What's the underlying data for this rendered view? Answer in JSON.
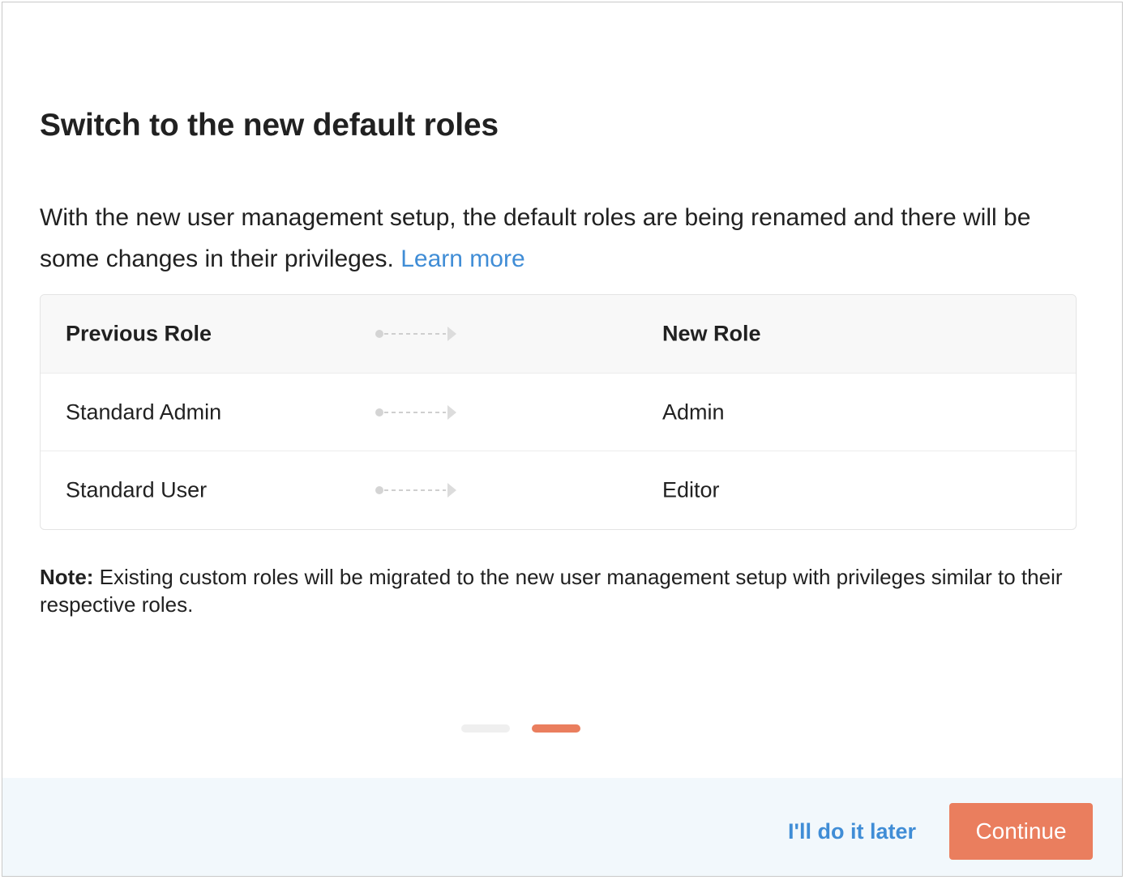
{
  "dialog": {
    "title": "Switch to the new default roles",
    "description": "With the new user management setup, the default roles are being renamed and there will be some changes in their privileges. ",
    "learn_more": "Learn more"
  },
  "table": {
    "header": {
      "previous": "Previous Role",
      "new": "New Role"
    },
    "rows": [
      {
        "previous": "Standard Admin",
        "new": "Admin"
      },
      {
        "previous": "Standard User",
        "new": "Editor"
      }
    ]
  },
  "note": {
    "label": "Note:",
    "text": " Existing custom roles will be migrated to the new user management setup with privileges similar to their respective roles."
  },
  "pagination": {
    "total": 2,
    "active": 2
  },
  "footer": {
    "later_label": "I'll do it later",
    "continue_label": "Continue"
  },
  "colors": {
    "accent": "#ea7e5e",
    "link": "#408dd6",
    "footer_bg": "#f2f8fc",
    "table_header_bg": "#f8f8f8"
  },
  "icons": {
    "row_arrow": "dashed-arrow-right-icon"
  }
}
